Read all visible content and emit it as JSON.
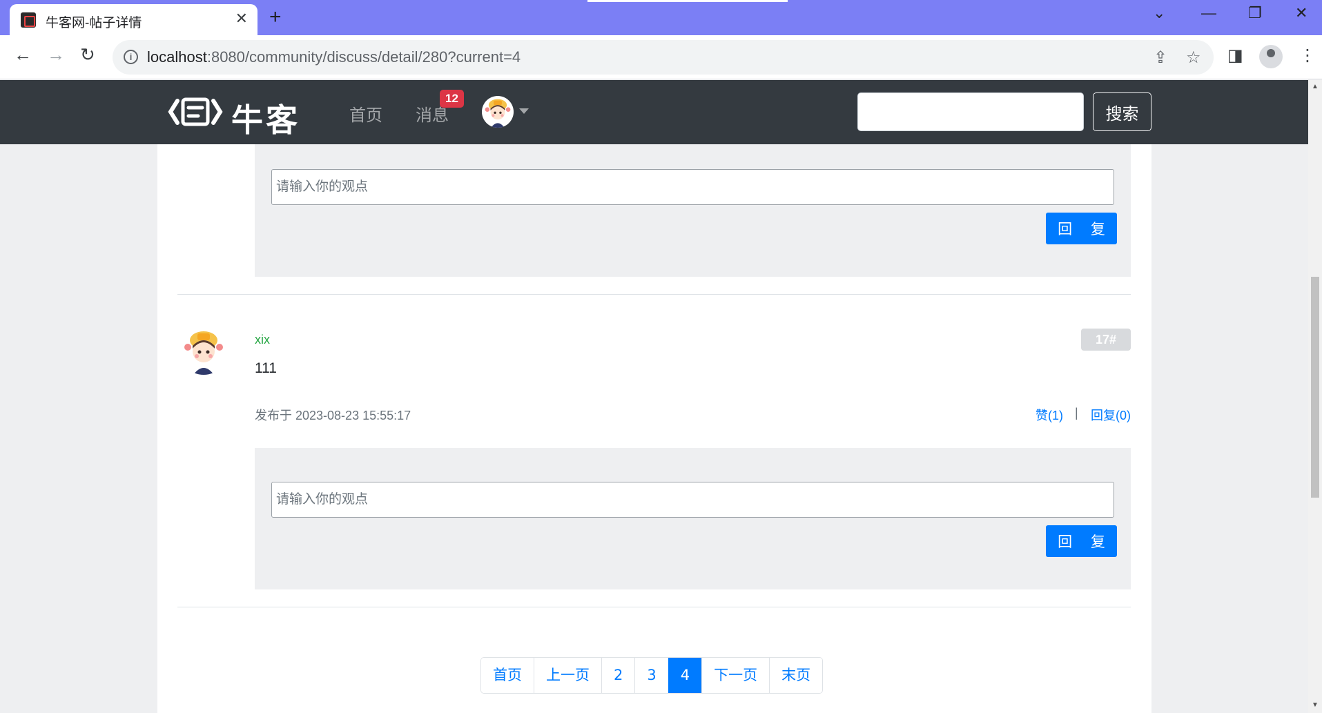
{
  "browser": {
    "tab_title": "牛客网-帖子详情",
    "url_host": "localhost",
    "url_rest": ":8080/community/discuss/detail/280?current=4"
  },
  "site": {
    "logo_text": "牛客",
    "nav": {
      "home": "首页",
      "messages": "消息",
      "message_count": "12"
    },
    "search_placeholder": "",
    "search_button": "搜索"
  },
  "reply_form": {
    "placeholder": "请输入你的观点",
    "button": "回 复"
  },
  "comment": {
    "username": "xix",
    "floor": "17#",
    "content": "111",
    "posted_at": "发布于 2023-08-23 15:55:17",
    "like_label": "赞(1)",
    "separator": "|",
    "reply_label": "回复(0)"
  },
  "pagination": {
    "first": "首页",
    "prev": "上一页",
    "pages": [
      "2",
      "3",
      "4"
    ],
    "current": "4",
    "next": "下一页",
    "last": "末页"
  },
  "colors": {
    "accent": "#007bff",
    "navbar": "#343a40",
    "username": "#28a745",
    "badge": "#dc3545",
    "titlebar": "#7b7ff5"
  }
}
